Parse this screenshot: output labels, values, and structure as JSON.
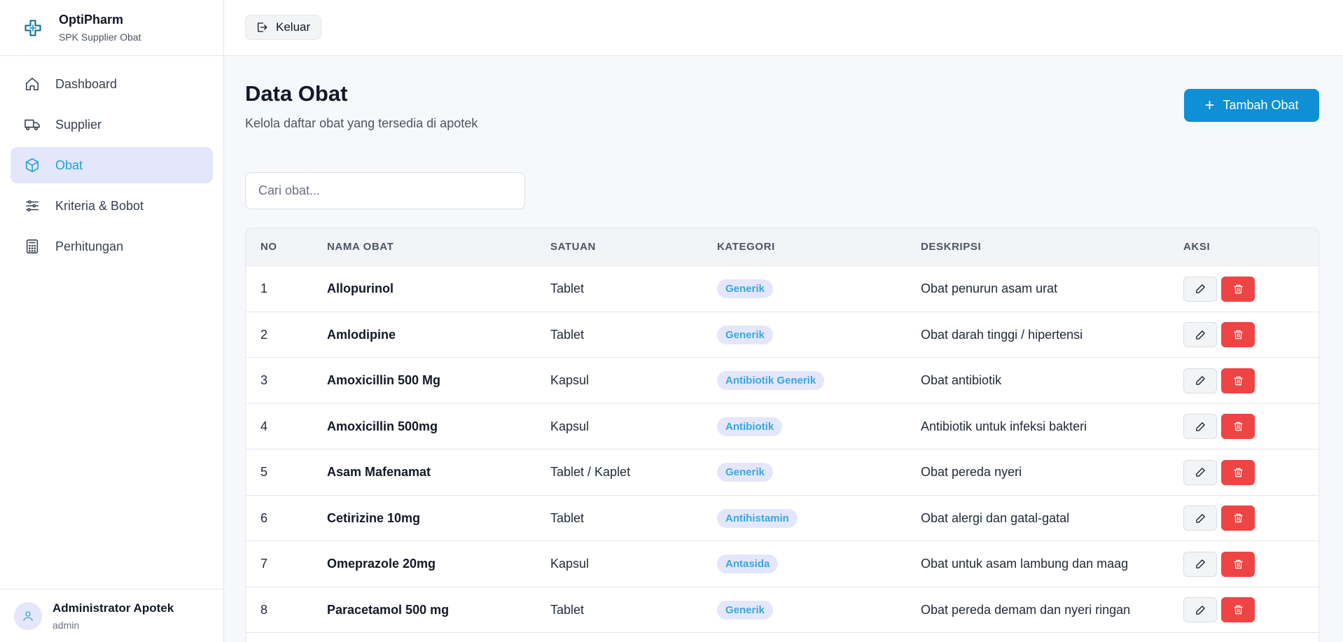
{
  "brand": {
    "name": "OptiPharm",
    "subtitle": "SPK Supplier Obat"
  },
  "nav": [
    {
      "label": "Dashboard",
      "icon": "home-icon",
      "active": false
    },
    {
      "label": "Supplier",
      "icon": "truck-icon",
      "active": false
    },
    {
      "label": "Obat",
      "icon": "box-icon",
      "active": true
    },
    {
      "label": "Kriteria & Bobot",
      "icon": "sliders-icon",
      "active": false
    },
    {
      "label": "Perhitungan",
      "icon": "calculator-icon",
      "active": false
    }
  ],
  "user": {
    "name": "Administrator Apotek",
    "role": "admin"
  },
  "topbar": {
    "logout_label": "Keluar"
  },
  "page": {
    "title": "Data Obat",
    "subtitle": "Kelola daftar obat yang tersedia di apotek",
    "add_label": "Tambah Obat"
  },
  "search": {
    "placeholder": "Cari obat..."
  },
  "table": {
    "headers": [
      "NO",
      "NAMA OBAT",
      "SATUAN",
      "KATEGORI",
      "DESKRIPSI",
      "AKSI"
    ],
    "rows": [
      {
        "no": "1",
        "name": "Allopurinol",
        "unit": "Tablet",
        "category": "Generik",
        "description": "Obat penurun asam urat"
      },
      {
        "no": "2",
        "name": "Amlodipine",
        "unit": "Tablet",
        "category": "Generik",
        "description": "Obat darah tinggi / hipertensi"
      },
      {
        "no": "3",
        "name": "Amoxicillin 500 Mg",
        "unit": "Kapsul",
        "category": "Antibiotik Generik",
        "description": "Obat antibiotik"
      },
      {
        "no": "4",
        "name": "Amoxicillin 500mg",
        "unit": "Kapsul",
        "category": "Antibiotik",
        "description": "Antibiotik untuk infeksi bakteri"
      },
      {
        "no": "5",
        "name": "Asam Mafenamat",
        "unit": "Tablet / Kaplet",
        "category": "Generik",
        "description": "Obat pereda nyeri"
      },
      {
        "no": "6",
        "name": "Cetirizine 10mg",
        "unit": "Tablet",
        "category": "Antihistamin",
        "description": "Obat alergi dan gatal-gatal"
      },
      {
        "no": "7",
        "name": "Omeprazole 20mg",
        "unit": "Kapsul",
        "category": "Antasida",
        "description": "Obat untuk asam lambung dan maag"
      },
      {
        "no": "8",
        "name": "Paracetamol 500 mg",
        "unit": "Tablet",
        "category": "Generik",
        "description": "Obat pereda demam dan nyeri ringan"
      }
    ]
  },
  "colors": {
    "accent": "#0e8fd6",
    "active_nav_bg": "#e4e7fb",
    "active_nav_text": "#1a9fdc",
    "danger": "#ef4444",
    "badge_text": "#38a7e0"
  }
}
